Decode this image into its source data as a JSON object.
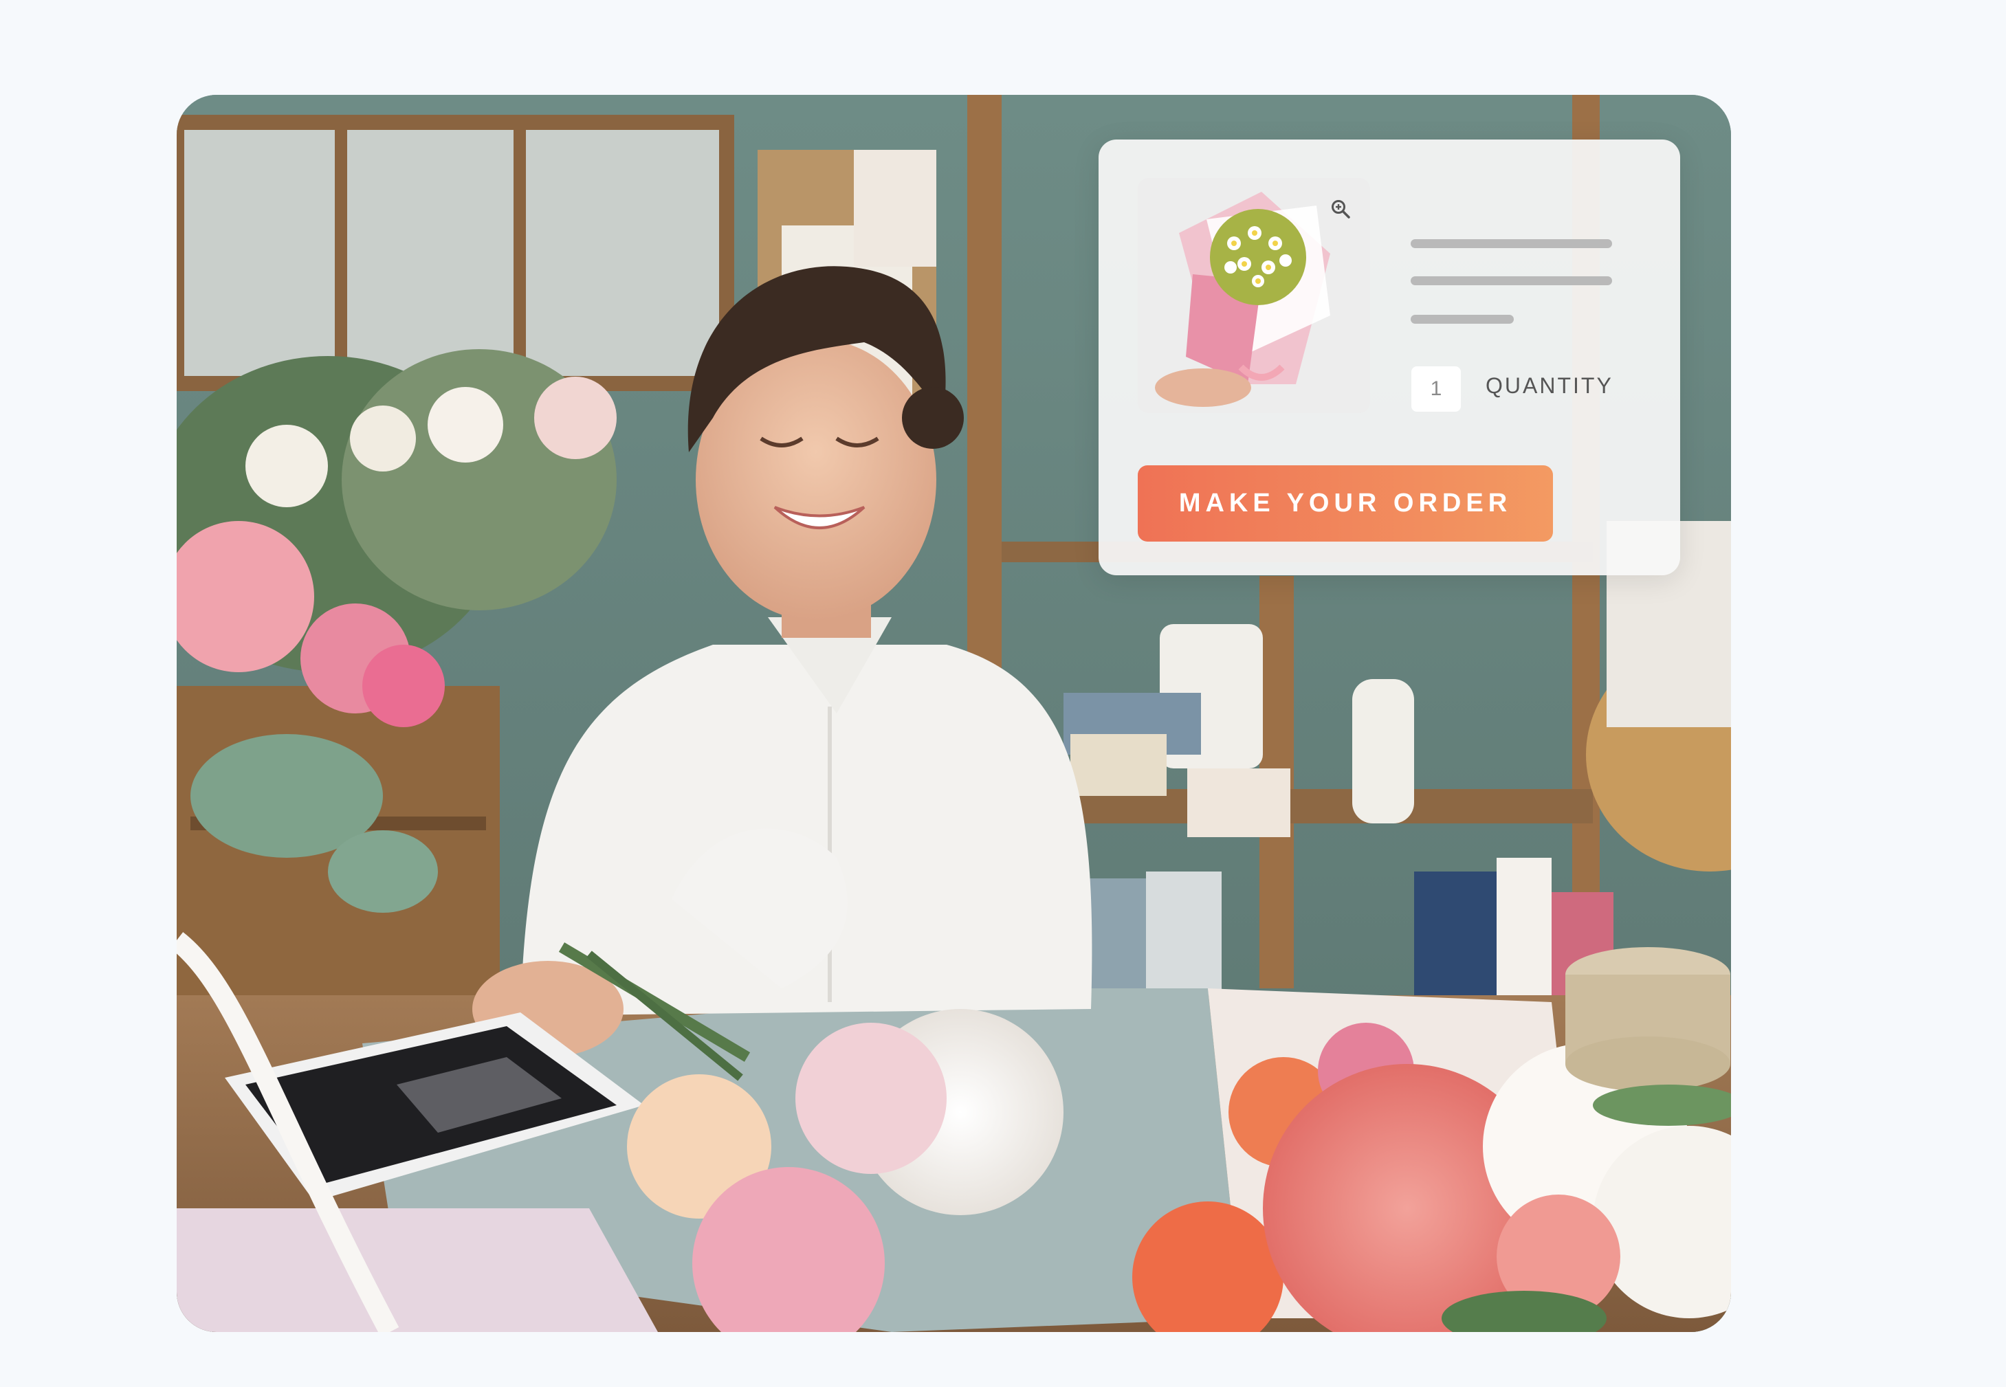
{
  "order_card": {
    "quantity_value": "1",
    "quantity_label": "QUANTITY",
    "order_button_label": "MAKE YOUR ORDER"
  },
  "icons": {
    "zoom": "zoom-in-icon"
  },
  "colors": {
    "button_gradient_start": "#ef7255",
    "button_gradient_end": "#f39a62",
    "panel_background": "#f7f7f7",
    "page_background": "#f6f9fc"
  }
}
